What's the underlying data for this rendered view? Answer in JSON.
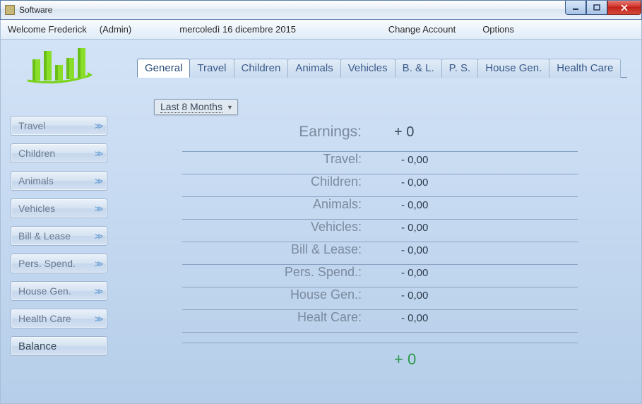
{
  "window": {
    "title": "Software"
  },
  "topbar": {
    "welcome": "Welcome Frederick",
    "role": "(Admin)",
    "date": "mercoledì 16 dicembre 2015",
    "change_account": "Change Account",
    "options": "Options"
  },
  "sidebar": {
    "items": [
      {
        "label": "Travel"
      },
      {
        "label": "Children"
      },
      {
        "label": "Animals"
      },
      {
        "label": "Vehicles"
      },
      {
        "label": "Bill & Lease"
      },
      {
        "label": "Pers. Spend."
      },
      {
        "label": "House Gen."
      },
      {
        "label": "Health Care"
      }
    ],
    "balance": "Balance"
  },
  "tabs": [
    {
      "label": "General"
    },
    {
      "label": "Travel"
    },
    {
      "label": "Children"
    },
    {
      "label": "Animals"
    },
    {
      "label": "Vehicles"
    },
    {
      "label": "B. & L."
    },
    {
      "label": "P. S."
    },
    {
      "label": "House Gen."
    },
    {
      "label": "Health Care"
    }
  ],
  "dropdown": {
    "selected": "Last 8 Months"
  },
  "summary": {
    "earnings_label": "Earnings:",
    "earnings_value": "+ 0",
    "rows": [
      {
        "label": "Travel:",
        "value": "- 0,00"
      },
      {
        "label": "Children:",
        "value": "- 0,00"
      },
      {
        "label": "Animals:",
        "value": "- 0,00"
      },
      {
        "label": "Vehicles:",
        "value": "- 0,00"
      },
      {
        "label": "Bill & Lease:",
        "value": "- 0,00"
      },
      {
        "label": "Pers. Spend.:",
        "value": "- 0,00"
      },
      {
        "label": "House Gen.:",
        "value": "- 0,00"
      },
      {
        "label": "Healt Care:",
        "value": "- 0,00"
      }
    ],
    "total": "+ 0"
  }
}
